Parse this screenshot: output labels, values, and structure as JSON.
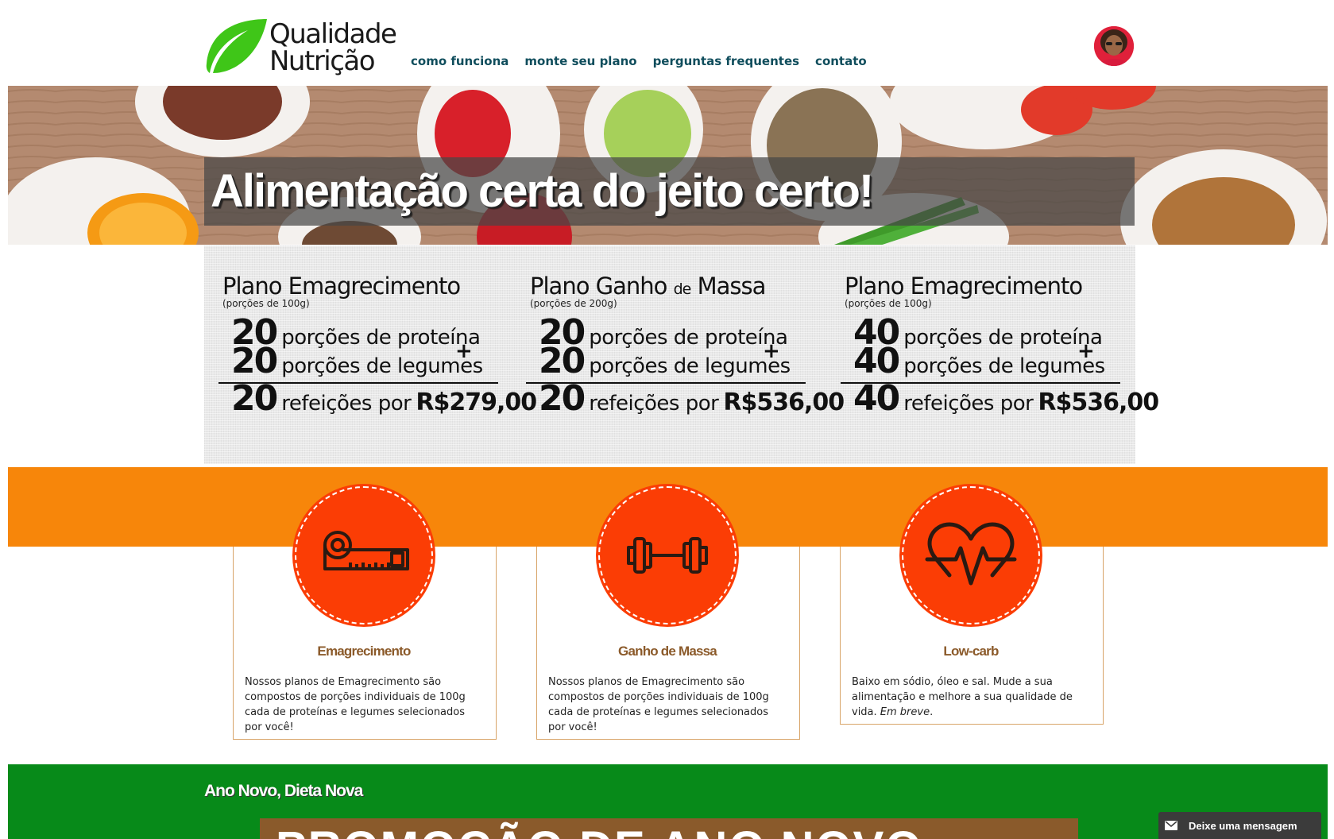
{
  "header": {
    "logo": {
      "line1": "Qualidade",
      "line2": "Nutrição"
    },
    "nav": [
      "como funciona",
      "monte seu plano",
      "perguntas frequentes",
      "contato"
    ]
  },
  "hero": {
    "title": "Alimentação certa do jeito certo!"
  },
  "plans": [
    {
      "title_a": "Plano Emagrecimento",
      "title_b": "",
      "title_c": "",
      "subtitle": "(porções de 100g)",
      "protein_qty": "20",
      "protein_label": "porções de proteína",
      "veg_qty": "20",
      "veg_label": "porções de legumes",
      "meals_qty": "20",
      "meals_label": "refeições por",
      "price": "R$279,00"
    },
    {
      "title_a": "Plano Ganho",
      "title_b": "de",
      "title_c": "Massa",
      "subtitle": "(porções de 200g)",
      "protein_qty": "20",
      "protein_label": "porções de proteína",
      "veg_qty": "20",
      "veg_label": "porções de legumes",
      "meals_qty": "20",
      "meals_label": "refeições por",
      "price": "R$536,00"
    },
    {
      "title_a": "Plano Emagrecimento",
      "title_b": "",
      "title_c": "",
      "subtitle": "(porções de 100g)",
      "protein_qty": "40",
      "protein_label": "porções de proteína",
      "veg_qty": "40",
      "veg_label": "porções de legumes",
      "meals_qty": "40",
      "meals_label": "refeições por",
      "price": "R$536,00"
    }
  ],
  "plus_sign": "+",
  "features": [
    {
      "title": "Emagrecimento",
      "text": "Nossos planos de Emagrecimento são compostos de porções individuais de 100g cada de proteínas e legumes selecionados por você!",
      "icon": "measuring-tape-icon"
    },
    {
      "title": "Ganho de Massa",
      "text": "Nossos planos de Emagrecimento são compostos de porções individuais de 100g cada de proteínas e legumes selecionados por você!",
      "icon": "dumbbell-icon"
    },
    {
      "title": "Low-carb",
      "text": "Baixo em sódio, óleo e sal. Mude a sua alimentação e melhore a sua qualidade de vida.",
      "text_em": "Em breve",
      "text_end": ".",
      "icon": "heartbeat-icon"
    }
  ],
  "promo_section": {
    "title": "Ano Novo, Dieta Nova",
    "banner_text": "PROMOÇÃO DE ANO NOVO"
  },
  "message_widget": {
    "label": "Deixe uma mensagem"
  },
  "colors": {
    "nav": "#0f4d5c",
    "orange": "#f7860a",
    "circle": "#fb3d05",
    "green": "#078a19",
    "card_title": "#8b5a2a",
    "logo_green": "#3fc618"
  }
}
